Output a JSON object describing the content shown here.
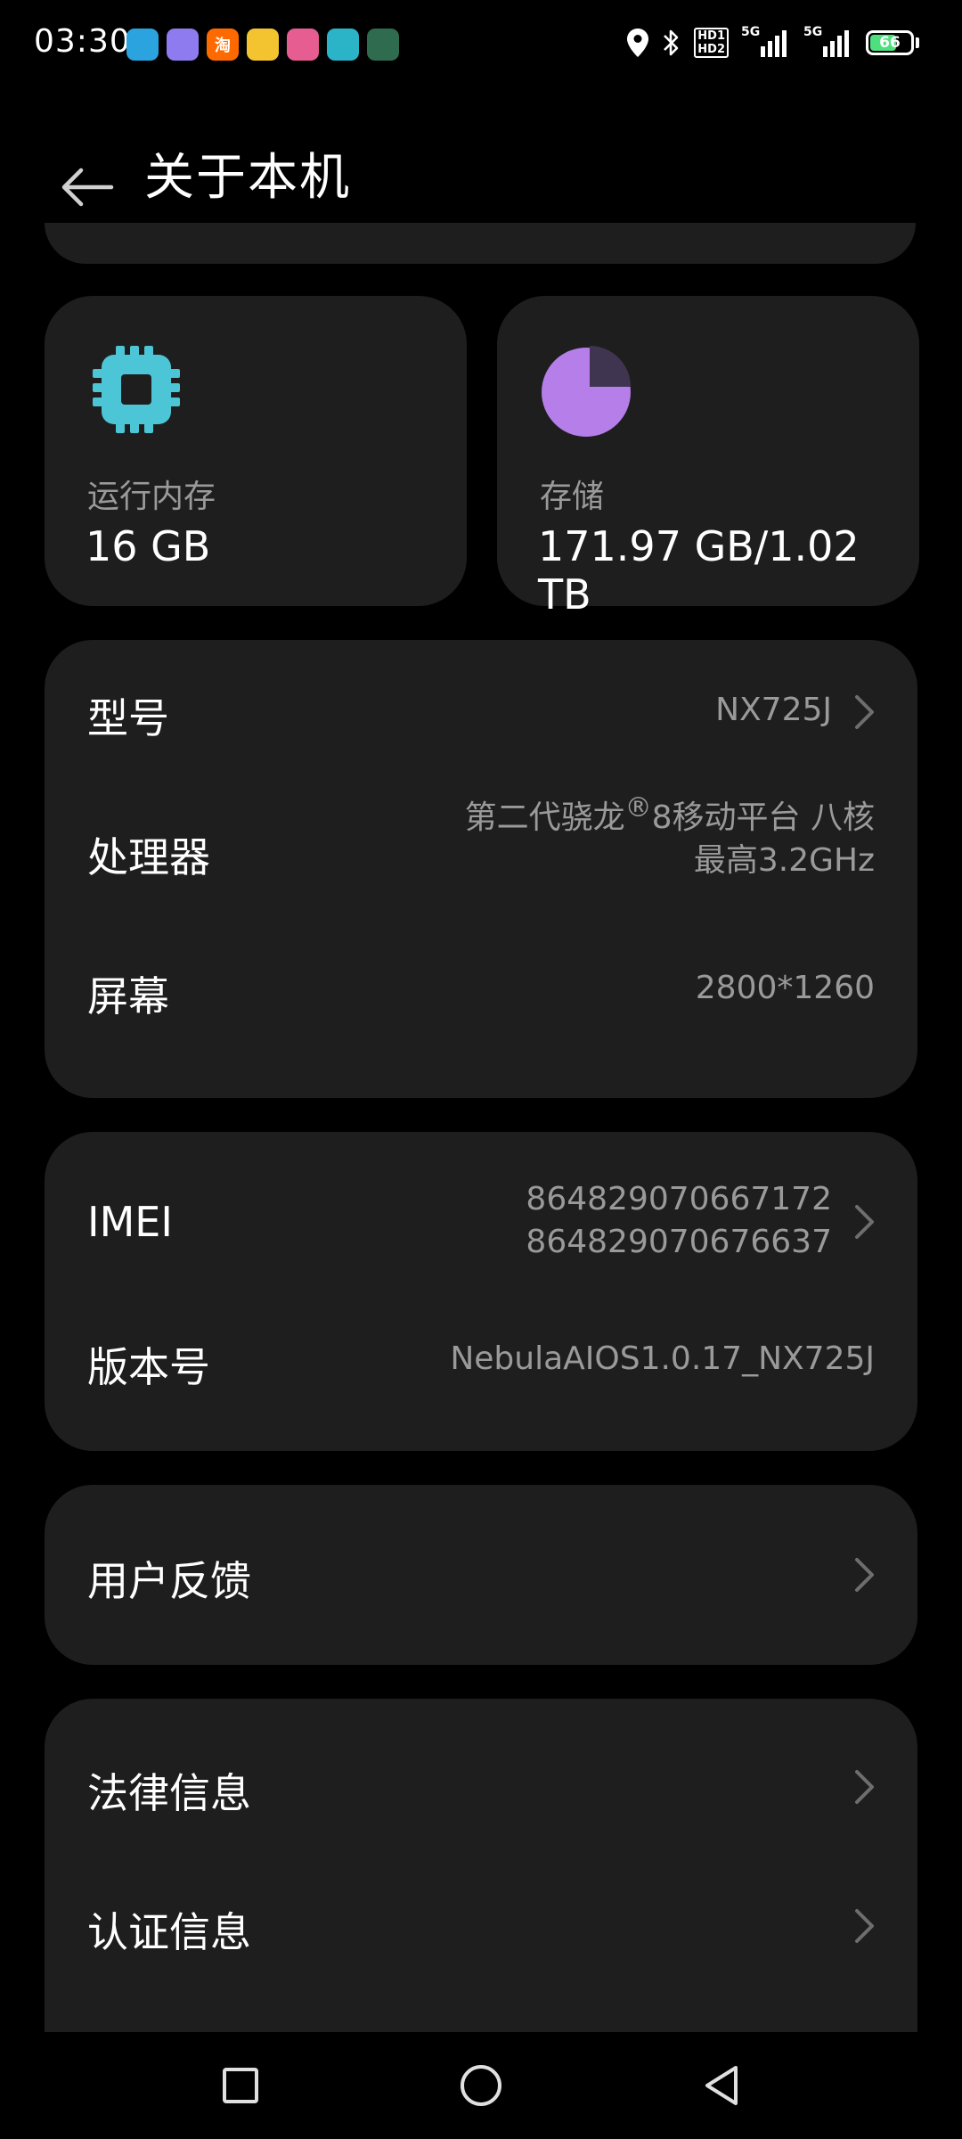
{
  "status_bar": {
    "time": "03:30",
    "app_icons": [
      {
        "icon": "telegram-icon",
        "color": "#2aa3df",
        "glyph": ""
      },
      {
        "icon": "cloud-app-icon",
        "color": "#8e7bf0",
        "glyph": ""
      },
      {
        "icon": "taobao-icon",
        "color": "#ff6a00",
        "glyph": "淘"
      },
      {
        "icon": "cartoon-app-icon",
        "color": "#f4c430",
        "glyph": ""
      },
      {
        "icon": "pink-app-icon",
        "color": "#e65d91",
        "glyph": ""
      },
      {
        "icon": "shield-app-icon",
        "color": "#2bb3c7",
        "glyph": ""
      },
      {
        "icon": "avatar-app-icon",
        "color": "#2f6b4f",
        "glyph": ""
      }
    ],
    "hd_top": "HD1",
    "hd_bottom": "HD2",
    "signal_1": "5G",
    "signal_2": "5G",
    "battery_level": "66",
    "battery_fraction": 0.66,
    "battery_color": "#4ee07e"
  },
  "header": {
    "title": "关于本机",
    "back_icon": "back-arrow-icon"
  },
  "stats": {
    "ram": {
      "icon": "chip-icon",
      "color": "#4cc6d6",
      "label": "运行内存",
      "value": "16 GB"
    },
    "storage": {
      "icon": "pie-chart-icon",
      "color": "#b57ee8",
      "used_fraction": 0.75,
      "label": "存储",
      "value": "171.97 GB/1.02 TB"
    }
  },
  "device_info": {
    "model": {
      "label": "型号",
      "value": "NX725J"
    },
    "processor": {
      "label": "处理器",
      "value_line1_pre": "第二代骁龙",
      "value_reg": "®",
      "value_line1_post": "8移动平台 八核",
      "value_line2": "最高3.2GHz"
    },
    "screen": {
      "label": "屏幕",
      "value": "2800*1260"
    }
  },
  "identity": {
    "imei": {
      "label": "IMEI",
      "value_1": "864829070667172",
      "value_2": "864829070676637"
    },
    "version": {
      "label": "版本号",
      "value": "NebulaAIOS1.0.17_NX725J"
    }
  },
  "feedback": {
    "label": "用户反馈"
  },
  "legal": {
    "legal_info": {
      "label": "法律信息"
    },
    "certification": {
      "label": "认证信息"
    }
  },
  "colors": {
    "background": "#000000",
    "card": "#1e1e1e",
    "secondary_text": "#9a9a9a",
    "chevron": "#6e6e6e"
  }
}
